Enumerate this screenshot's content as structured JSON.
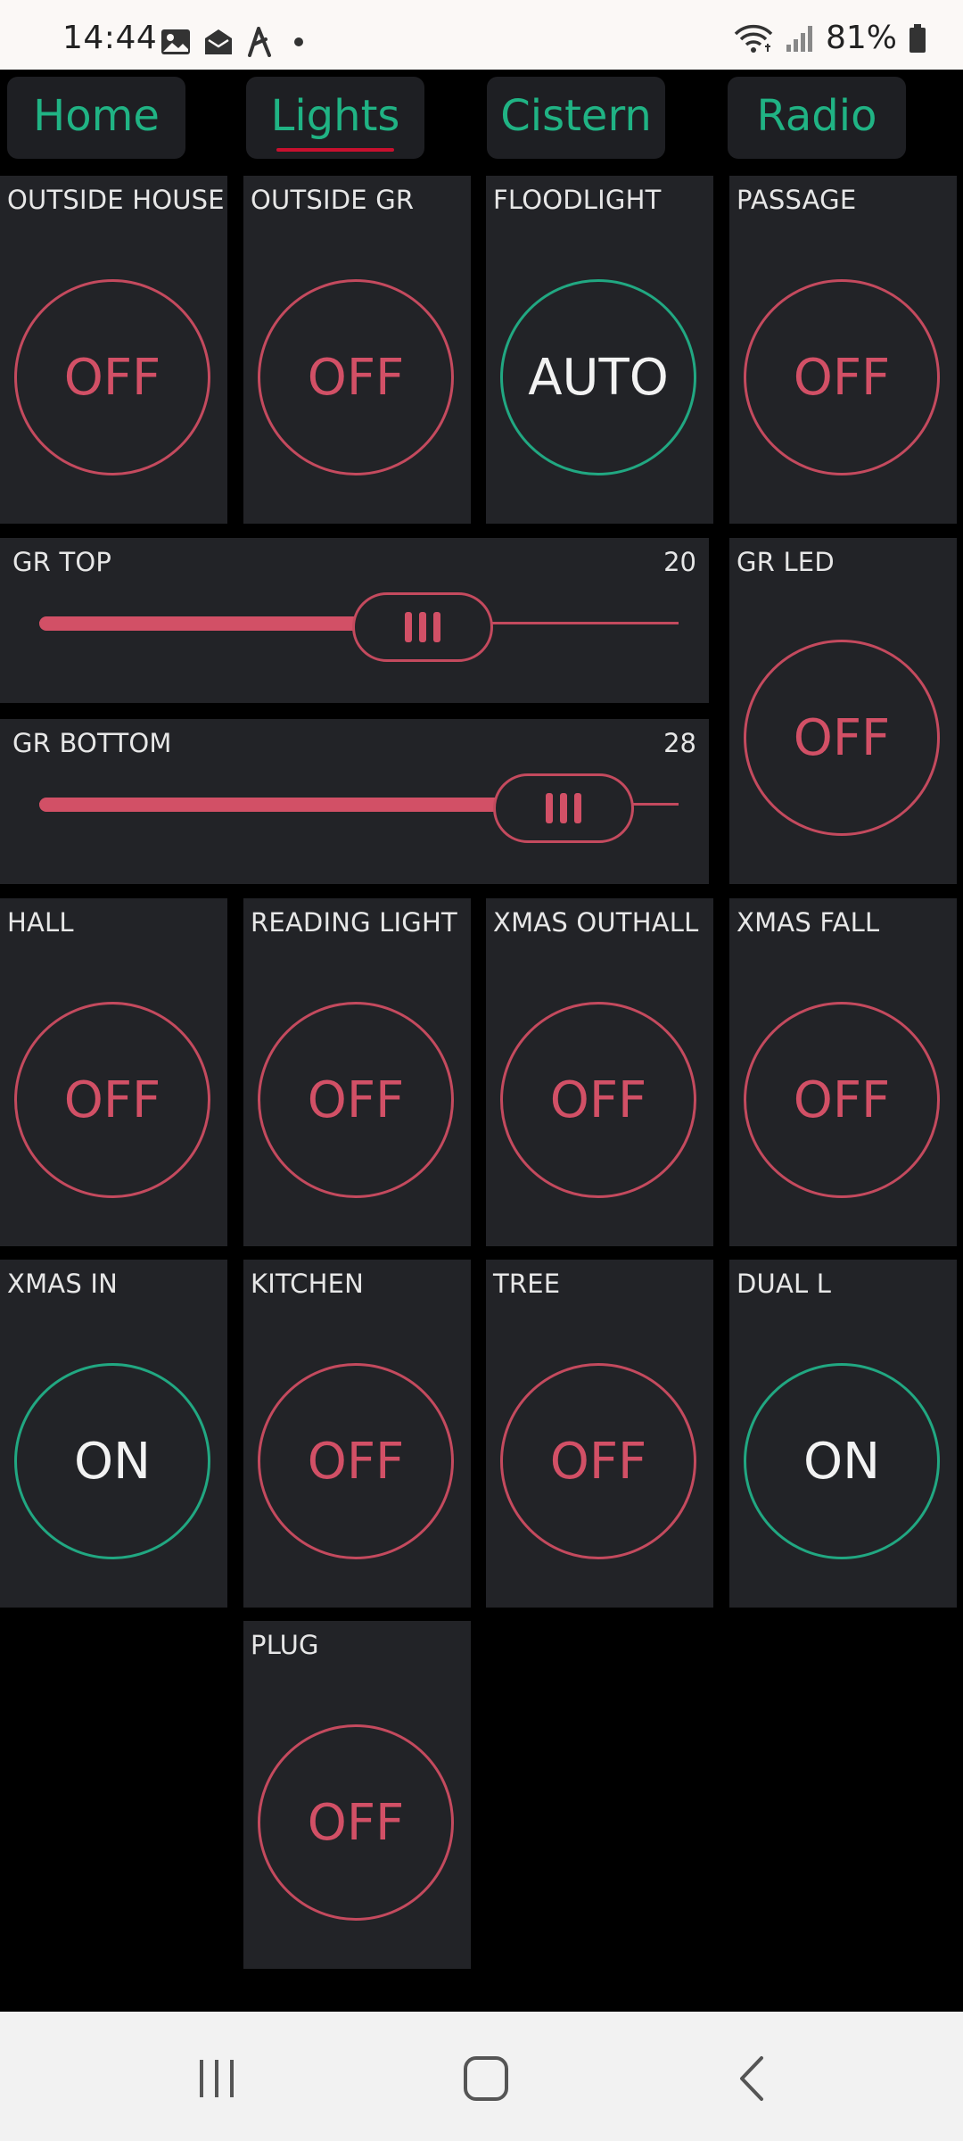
{
  "status_bar": {
    "time": "14:44",
    "battery": "81%",
    "icons_left": [
      "image-icon",
      "mail-open-icon",
      "lightning-icon",
      "dot-icon"
    ],
    "icons_right": [
      "wifi-icon",
      "signal-icon",
      "battery-icon"
    ]
  },
  "tabs": [
    {
      "label": "Home",
      "active": false
    },
    {
      "label": "Lights",
      "active": true
    },
    {
      "label": "Cistern",
      "active": false
    },
    {
      "label": "Radio",
      "active": false
    }
  ],
  "tiles": {
    "outside_house": {
      "label": "OUTSIDE HOUSE",
      "state": "OFF"
    },
    "outside_gr": {
      "label": "OUTSIDE GR",
      "state": "OFF"
    },
    "floodlight": {
      "label": "FLOODLIGHT",
      "state": "AUTO"
    },
    "passage": {
      "label": "PASSAGE",
      "state": "OFF"
    },
    "gr_led": {
      "label": "GR LED",
      "state": "OFF"
    },
    "hall": {
      "label": "HALL",
      "state": "OFF"
    },
    "reading_light": {
      "label": "READING LIGHT",
      "state": "OFF"
    },
    "xmas_outhall": {
      "label": "XMAS OUTHALL",
      "state": "OFF"
    },
    "xmas_fall": {
      "label": "XMAS FALL",
      "state": "OFF"
    },
    "xmas_in": {
      "label": "XMAS IN",
      "state": "ON"
    },
    "kitchen": {
      "label": "KITCHEN",
      "state": "OFF"
    },
    "tree": {
      "label": "TREE",
      "state": "OFF"
    },
    "dual_l": {
      "label": "DUAL L",
      "state": "ON"
    },
    "plug": {
      "label": "PLUG",
      "state": "OFF"
    }
  },
  "sliders": {
    "gr_top": {
      "label": "GR TOP",
      "value": "20",
      "fill_fraction": 0.6
    },
    "gr_bottom": {
      "label": "GR BOTTOM",
      "value": "28",
      "fill_fraction": 0.82
    }
  },
  "colors": {
    "accent_on": "#21a882",
    "accent_off": "#d25066",
    "tile_bg": "#222327",
    "tab_text": "#20b384"
  },
  "navbar": {
    "icons": [
      "recent-apps-icon",
      "home-icon",
      "back-icon"
    ]
  }
}
